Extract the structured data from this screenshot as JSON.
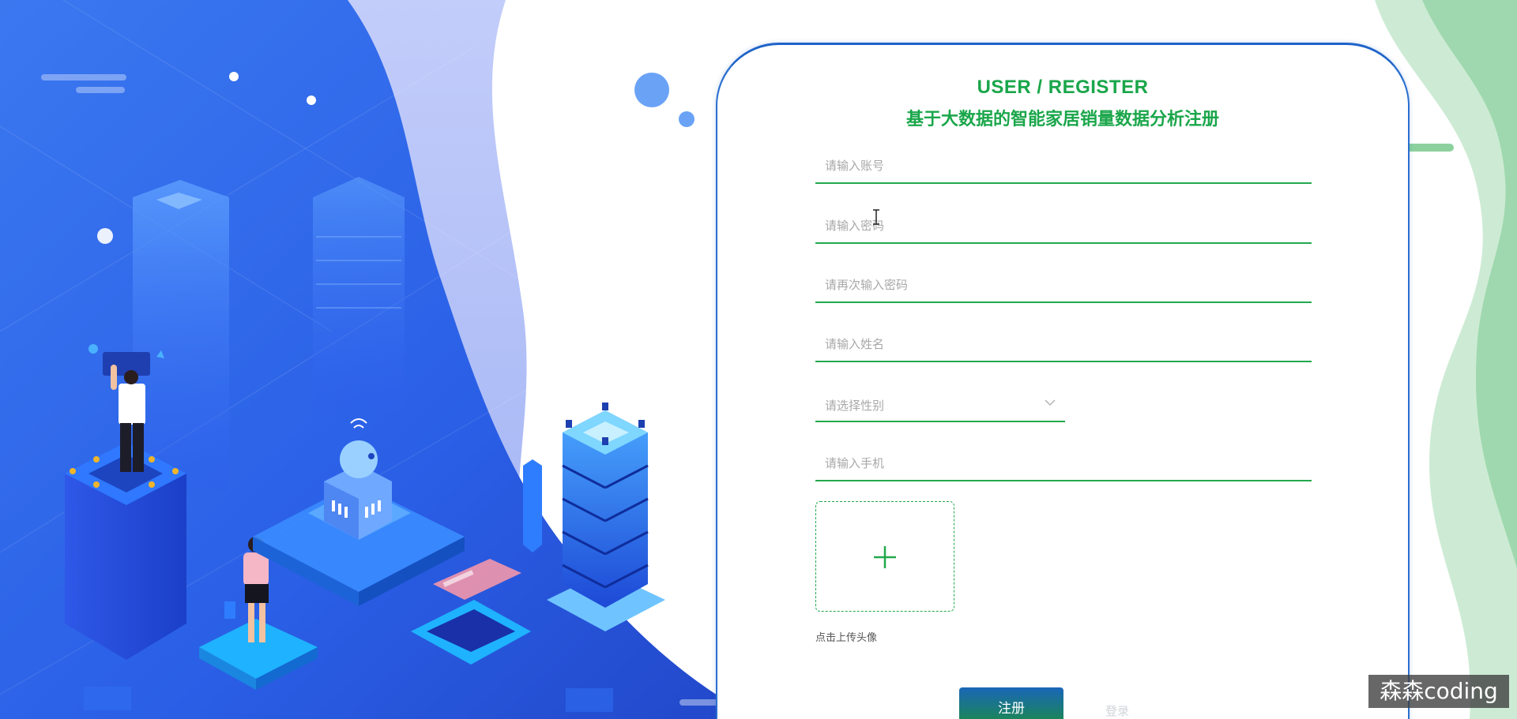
{
  "form": {
    "title_en": "USER / REGISTER",
    "title_cn": "基于大数据的智能家居销量数据分析注册",
    "account_placeholder": "请输入账号",
    "password_placeholder": "请输入密码",
    "confirm_password_placeholder": "请再次输入密码",
    "name_placeholder": "请输入姓名",
    "gender_placeholder": "请选择性别",
    "phone_placeholder": "请输入手机",
    "upload_hint": "点击上传头像",
    "register_label": "注册",
    "secondary_label": "登录"
  },
  "watermark": "森森coding",
  "colors": {
    "accent_green": "#22a84d",
    "title_green": "#1aa64a",
    "card_border_blue": "#1e63c8",
    "button_top": "#1a66b8",
    "button_bottom": "#1b8a4a"
  },
  "icons": {
    "gender_select": "chevron-down-icon",
    "upload": "plus-icon"
  }
}
